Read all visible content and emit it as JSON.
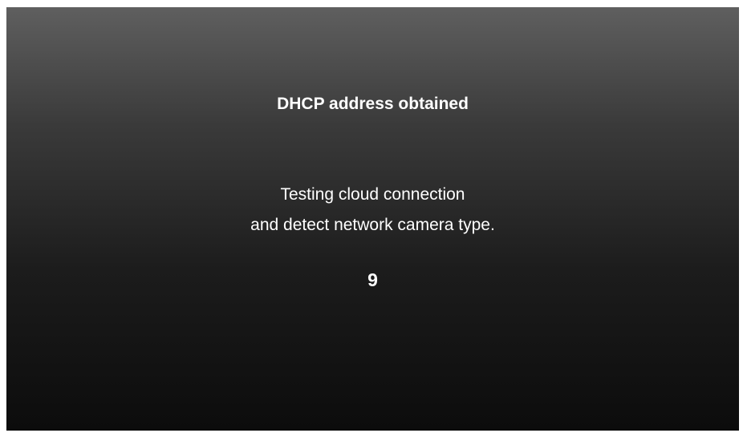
{
  "screen": {
    "title": "DHCP address obtained",
    "message_line1": "Testing cloud connection",
    "message_line2": "and detect network camera type.",
    "countdown": "9"
  },
  "colors": {
    "gradient_top": "#5f5f5f",
    "gradient_bottom": "#0c0c0c",
    "text": "#ffffff"
  }
}
